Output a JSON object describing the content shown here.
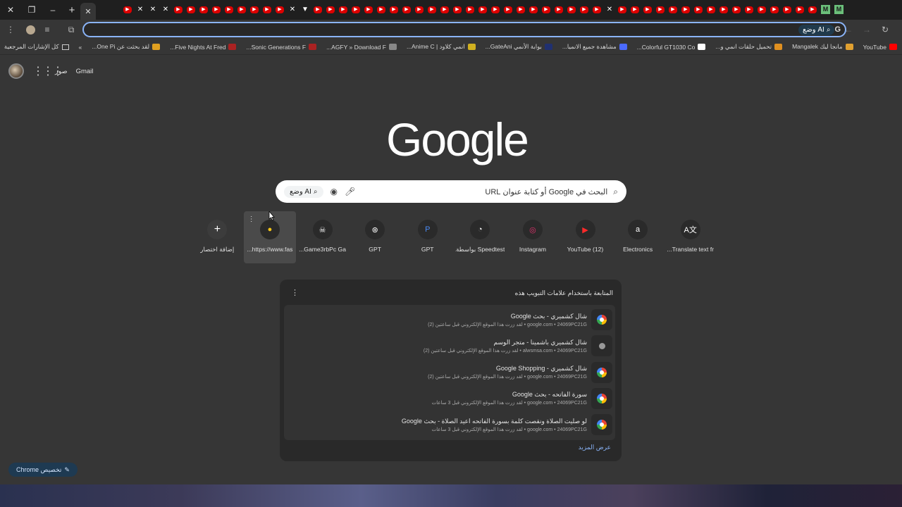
{
  "browser": {
    "window_controls": {
      "close": "✕",
      "restore": "❐",
      "minimize": "–"
    },
    "new_tab": "+",
    "active_tab_close": "✕",
    "tab_favicons": [
      "▶",
      "✕",
      "✕",
      "✕",
      "▶",
      "▶",
      "▶",
      "▶",
      "▶",
      "▶",
      "▶",
      "▶",
      "▶",
      "✕",
      "▼",
      "▶",
      "▶",
      "▶",
      "▶",
      "▶",
      "▶",
      "▶",
      "▶",
      "▶",
      "▶",
      "▶",
      "▶",
      "▶",
      "▶",
      "▶",
      "▶",
      "▶",
      "▶",
      "▶",
      "▶",
      "▶",
      "▶",
      "▶",
      "✕",
      "▶",
      "▶",
      "▶",
      "▶",
      "▶",
      "▶",
      "▶",
      "▶",
      "▶",
      "▶",
      "▶",
      "▶",
      "▶",
      "▶",
      "▶",
      "▶",
      "M",
      "M"
    ],
    "omnibox": {
      "ai_mode_label": "وضع AI",
      "value": ""
    },
    "bookmarks": [
      {
        "label": "YouTube",
        "color": "#ff0000"
      },
      {
        "label": "مانجا ليك Mangalek",
        "color": "#e0a030"
      },
      {
        "label": "تحميل حلقات انمي و...",
        "color": "#e09020"
      },
      {
        "label": "Colorful GT1030 Co...",
        "color": "#ffffff"
      },
      {
        "label": "مشاهدة جميع الانميا...",
        "color": "#4a6aff"
      },
      {
        "label": "بوابة الأنمي GateAni...",
        "color": "#203070"
      },
      {
        "label": "انمي كلاود | Anime C...",
        "color": "#d0b020"
      },
      {
        "label": "AGFY » Download F...",
        "color": "#888888"
      },
      {
        "label": "Sonic Generations F...",
        "color": "#aa2222"
      },
      {
        "label": "Five Nights At Fred...",
        "color": "#aa2222"
      },
      {
        "label": "لقد بحثت عن One Pi...",
        "color": "#e0a020"
      }
    ],
    "bookmarks_overflow": "»",
    "all_bookmarks_label": "كل الإشارات المرجعية"
  },
  "header": {
    "gmail": "Gmail",
    "images": "صور"
  },
  "logo_text": "Google",
  "search": {
    "placeholder": "البحث في Google أو كتابة عنوان URL",
    "ai_mode_label": "وضع AI"
  },
  "shortcuts": [
    {
      "label": "Translate text fr...",
      "icon": "A文",
      "bg": "#2a2a2a"
    },
    {
      "label": "Electronics",
      "icon": "a",
      "bg": "#2a2a2a"
    },
    {
      "label": "(12) YouTube",
      "icon": "▶",
      "bg": "#2a2a2a"
    },
    {
      "label": "Instagram",
      "icon": "◎",
      "bg": "#2a2a2a"
    },
    {
      "label": "Speedtest بواسطة...",
      "icon": "◔",
      "bg": "#2a2a2a"
    },
    {
      "label": "GPT",
      "icon": "P",
      "bg": "#2a2a2a"
    },
    {
      "label": "GPT",
      "icon": "⊛",
      "bg": "#2a2a2a"
    },
    {
      "label": "Game3rbPc Ga...",
      "icon": "☠",
      "bg": "#2a2a2a"
    },
    {
      "label": "https://www.fas...",
      "icon": "●",
      "bg": "#2a2a2a"
    },
    {
      "label": "إضافة اختصار",
      "icon": "+",
      "bg": "#2a2a2a"
    }
  ],
  "journey_card": {
    "title": "المتابعة باستخدام علامات التبويب هذه",
    "items": [
      {
        "title": "شال كشميري - بحث Google",
        "subtitle": "google.com • 24069PC21G • لقد زرت هذا الموقع الإلكتروني قبل ساعتين (2)",
        "icon": "google"
      },
      {
        "title": "شال كشميري باشمينا - متجر الوسم",
        "subtitle": "alwsmsa.com • 24069PC21G • لقد زرت هذا الموقع الإلكتروني قبل ساعتين (2)",
        "icon": "web"
      },
      {
        "title": "شال كشميري - Google Shopping",
        "subtitle": "google.com • 24069PC21G • لقد زرت هذا الموقع الإلكتروني قبل ساعتين (2)",
        "icon": "google"
      },
      {
        "title": "سورة الفاتحه - بحث Google",
        "subtitle": "google.com • 24069PC21G • لقد زرت هذا الموقع الإلكتروني قبل 3 ساعات",
        "icon": "google"
      },
      {
        "title": "لو صليت الصلاة ونقصت كلمة بسورة الفاتحه اعيد الصلاة - بحث Google",
        "subtitle": "google.com • 24069PC21G • لقد زرت هذا الموقع الإلكتروني قبل 3 ساعات",
        "icon": "google"
      }
    ],
    "show_more": "عرض المزيد"
  },
  "customize_chrome": "تخصيص Chrome"
}
